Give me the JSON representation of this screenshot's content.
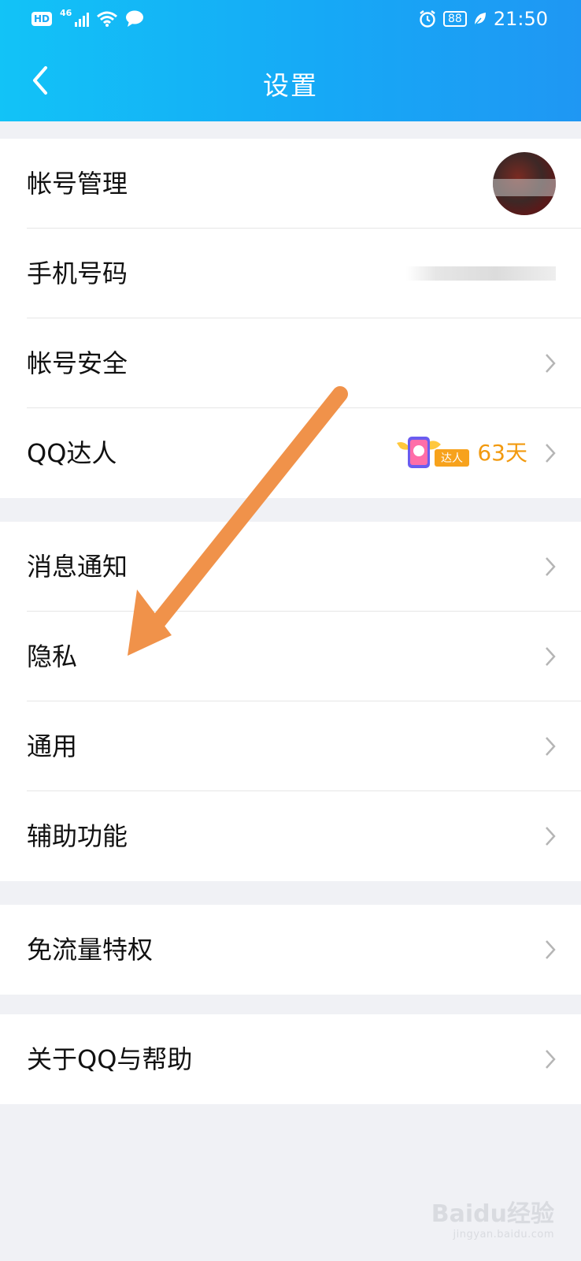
{
  "status_bar": {
    "hd": "HD",
    "network": "46",
    "battery": "88",
    "time": "21:50"
  },
  "header": {
    "title": "设置",
    "back_icon": "chevron-left-icon"
  },
  "groups": [
    {
      "items": [
        {
          "label": "帐号管理",
          "accessory": "avatar"
        },
        {
          "label": "手机号码",
          "accessory": "blurred-value"
        },
        {
          "label": "帐号安全",
          "accessory": "chevron"
        },
        {
          "label": "QQ达人",
          "accessory": "badge",
          "badge_text": "达人",
          "badge_days": "63天"
        }
      ]
    },
    {
      "items": [
        {
          "label": "消息通知",
          "accessory": "chevron"
        },
        {
          "label": "隐私",
          "accessory": "chevron"
        },
        {
          "label": "通用",
          "accessory": "chevron"
        },
        {
          "label": "辅助功能",
          "accessory": "chevron"
        }
      ]
    },
    {
      "items": [
        {
          "label": "免流量特权",
          "accessory": "chevron"
        }
      ]
    },
    {
      "items": [
        {
          "label": "关于QQ与帮助",
          "accessory": "chevron"
        }
      ]
    }
  ],
  "colors": {
    "header_gradient_start": "#12c3f7",
    "header_gradient_end": "#1f97f3",
    "background": "#f0f1f5",
    "badge_days": "#f29a0f",
    "annotation_arrow": "#f0924a"
  },
  "watermark": {
    "main": "Baidu经验",
    "sub": "jingyan.baidu.com"
  }
}
